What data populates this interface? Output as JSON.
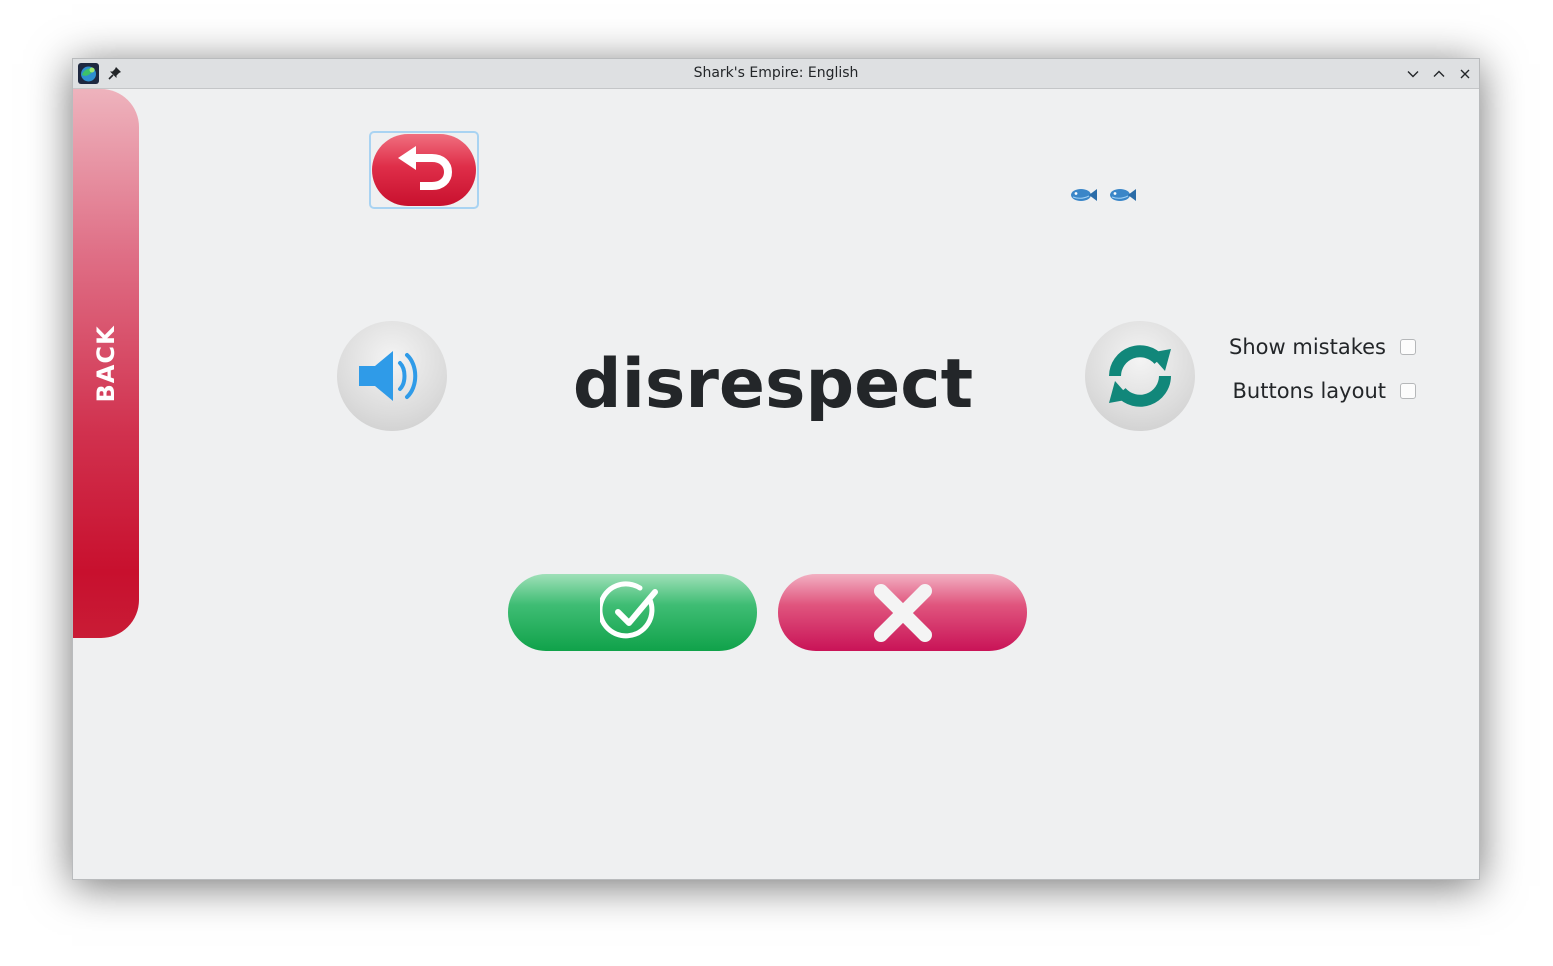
{
  "window": {
    "title": "Shark's Empire: English",
    "controls": [
      "minimize-icon",
      "maximize-icon",
      "close-icon"
    ]
  },
  "sidebar": {
    "back_label": "BACK",
    "color": "#c8102e"
  },
  "toolbar": {
    "undo_icon": "undo-arrow-icon",
    "lives_icon": "fish-icon",
    "lives_count": 2
  },
  "card": {
    "word": "disrespect",
    "speak_icon": "speaker-icon",
    "refresh_icon": "refresh-icon"
  },
  "options": {
    "show_mistakes_label": "Show mistakes",
    "show_mistakes_checked": false,
    "buttons_layout_label": "Buttons layout",
    "buttons_layout_checked": false
  },
  "answers": {
    "correct_icon": "check-circle-icon",
    "wrong_icon": "cross-icon",
    "correct_color": "#10a24a",
    "wrong_color": "#c91357"
  }
}
